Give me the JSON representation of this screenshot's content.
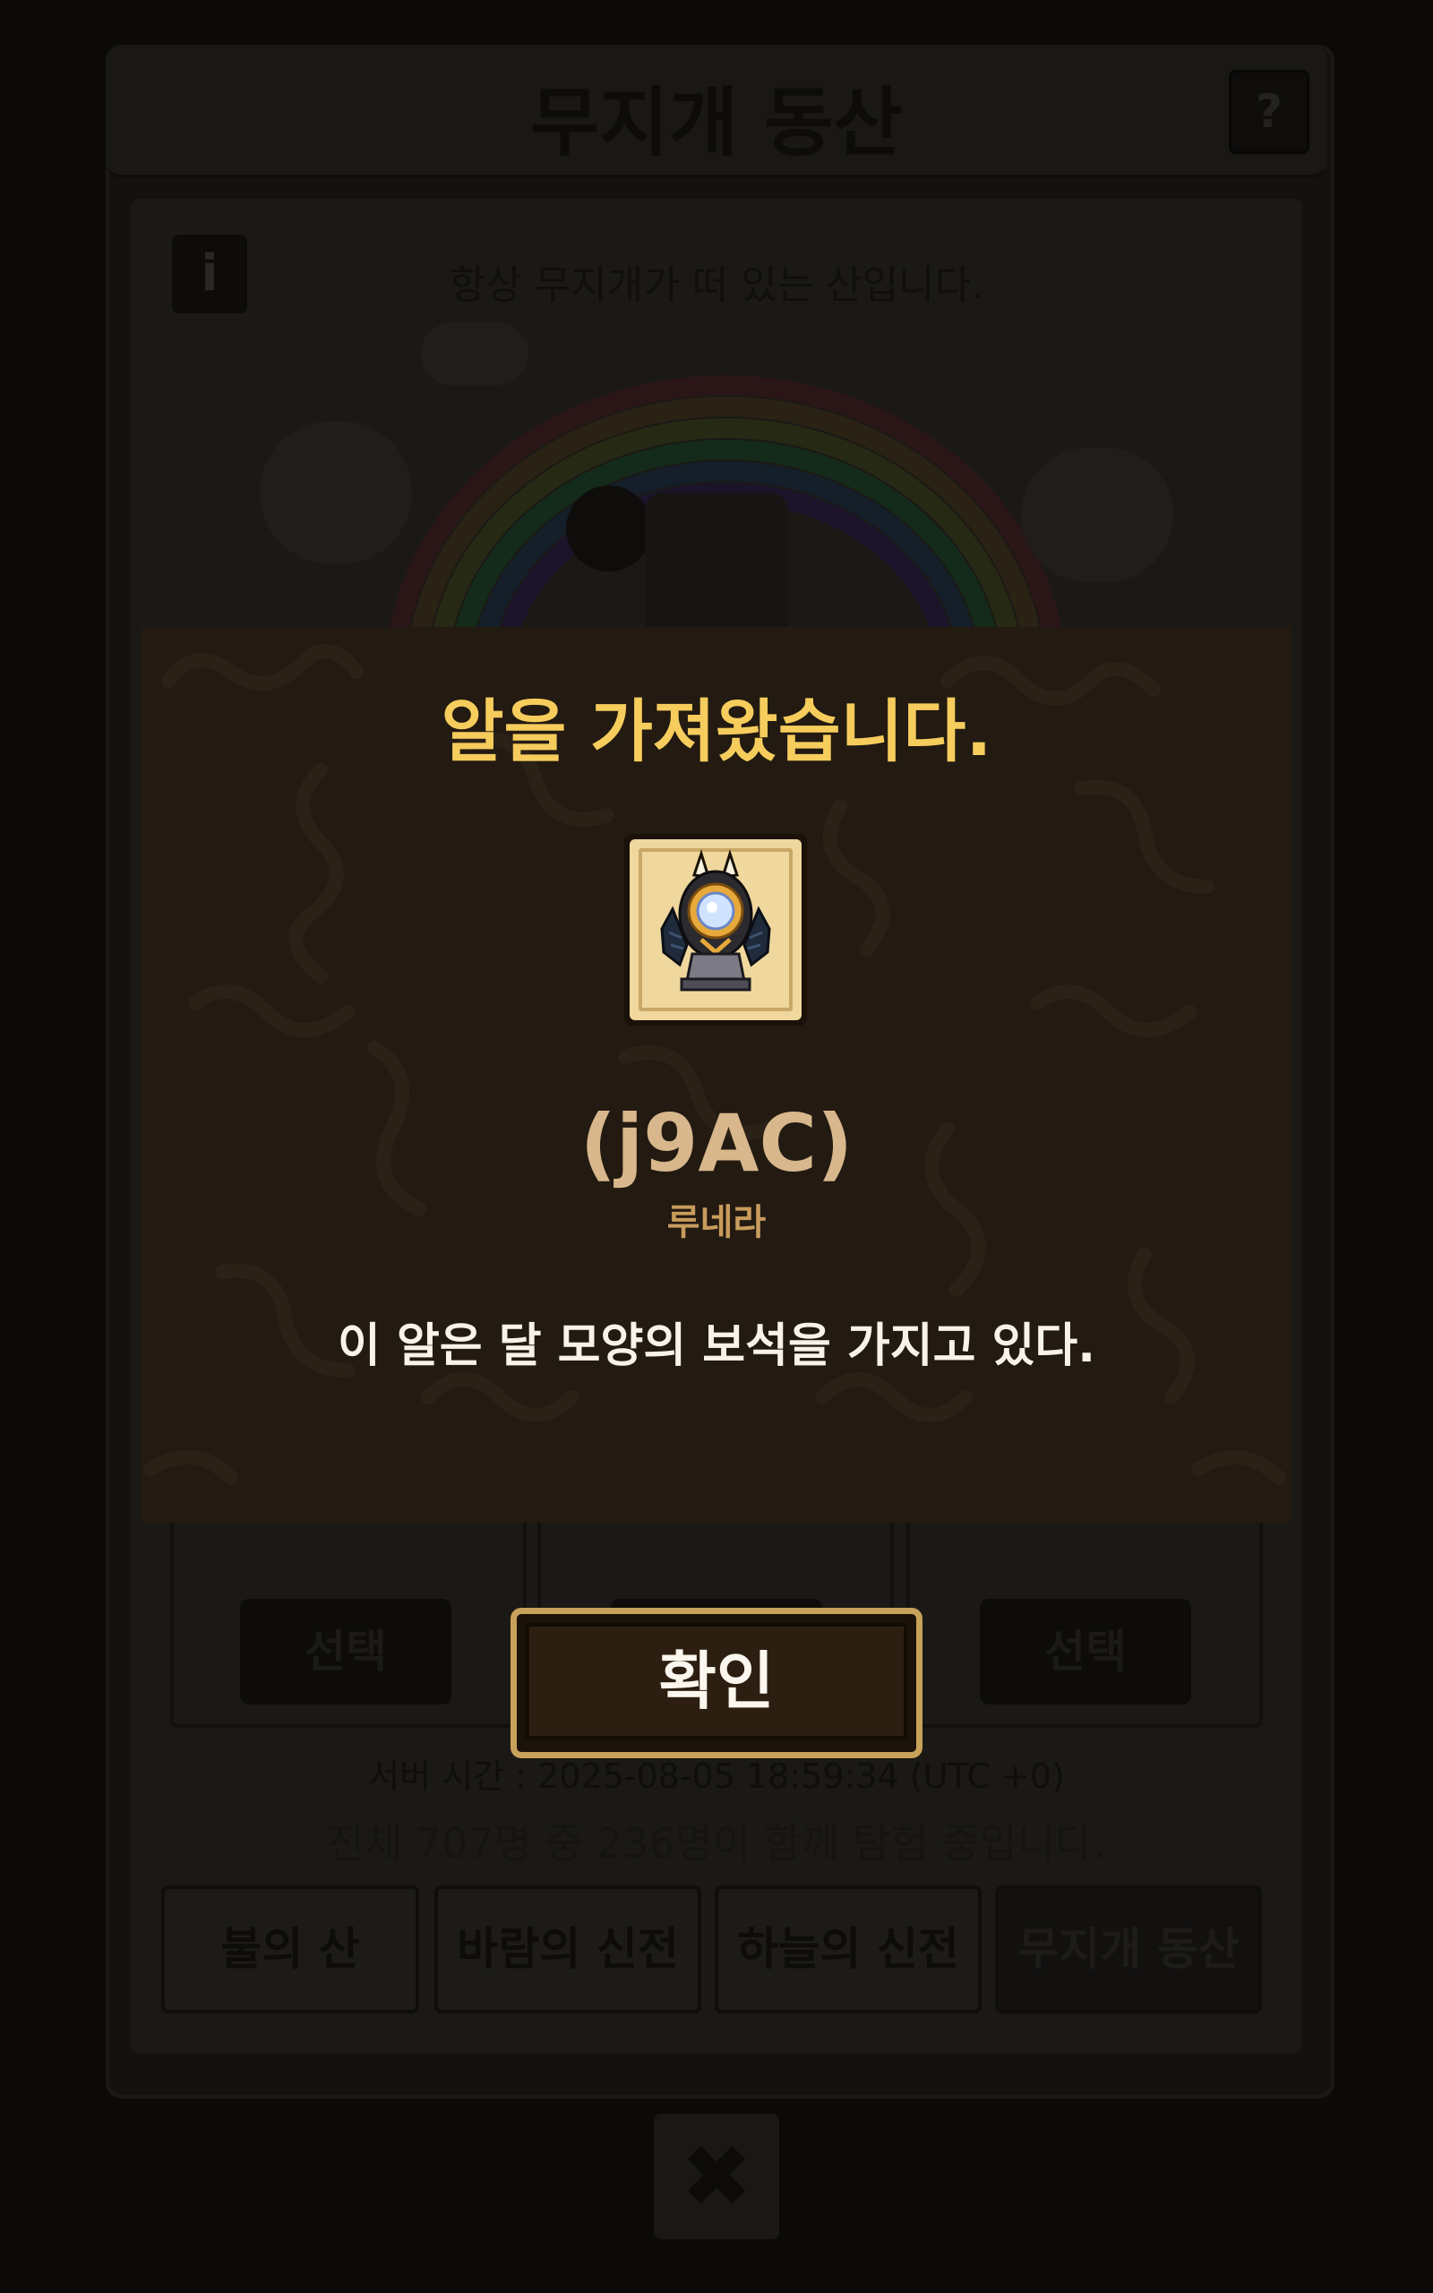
{
  "background": {
    "title": "무지개 동산",
    "help_label": "?",
    "info_label": "i",
    "description": "항상 무지개가 떠 있는 산입니다.",
    "select_buttons": [
      "선택",
      "선택",
      "선택"
    ],
    "server_time": "서버 시간 : 2025-08-05 18:59:34 (UTC +0)",
    "participants": "전체 707명 중 236명이 함께 탐험 중입니다.",
    "tabs": [
      {
        "label": "불의 산",
        "active": false
      },
      {
        "label": "바람의 신전",
        "active": false
      },
      {
        "label": "하늘의 신전",
        "active": false
      },
      {
        "label": "무지개 동산",
        "active": true
      }
    ],
    "close_label": "✖"
  },
  "modal": {
    "title": "알을 가져왔습니다.",
    "egg_code": "(j9AC)",
    "egg_name": "루네라",
    "egg_description": "이 알은 달 모양의 보석을 가지고 있다.",
    "egg_icon": "moon-gem-egg-icon"
  },
  "confirm": {
    "label": "확인"
  },
  "colors": {
    "modal_bg": "#231a12",
    "title": "#f6cc5c",
    "egg_code": "#d7b78b",
    "egg_name": "#c89c5c",
    "button_border": "#c8a15a"
  }
}
